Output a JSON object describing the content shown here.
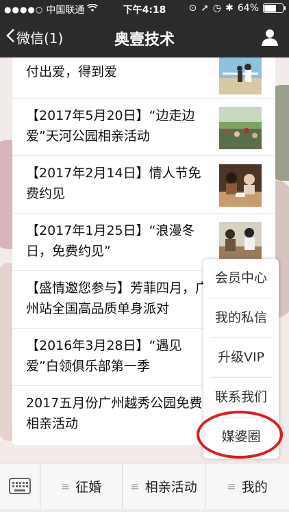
{
  "status_bar": {
    "carrier": "中国联通",
    "time": "下午4:18",
    "battery": "64%",
    "battery_level": 0.64
  },
  "nav": {
    "back_label": "微信(1)",
    "title": "奥壹技术"
  },
  "articles": [
    {
      "title": "付出爱，得到爱",
      "thumb": "couple-beach"
    },
    {
      "title": "【2017年5月20日】“边走边爱”天河公园相亲活动",
      "thumb": "park-crowd"
    },
    {
      "title": "【2017年2月14日】情人节免费约见",
      "thumb": "valentine-dinner"
    },
    {
      "title": "【2017年1月25日】“浪漫冬日，免费约见”",
      "thumb": "winter-date"
    },
    {
      "title": "【盛情邀您参与】芳菲四月，广州站全国高品质单身派对",
      "thumb": ""
    },
    {
      "title": "【2016年3月28日】“遇见爱”白领俱乐部第一季",
      "thumb": ""
    },
    {
      "title": "2017五月份广州越秀公园免费相亲活动",
      "thumb": ""
    }
  ],
  "menu": {
    "items": [
      "会员中心",
      "我的私信",
      "升级VIP",
      "联系我们",
      "媒婆圈"
    ],
    "highlight_color": "#e01b1b"
  },
  "tabbar": {
    "tabs": [
      "征婚",
      "相亲活动",
      "我的"
    ]
  },
  "colors": {
    "nav_bg": "#2c2c2c",
    "status_bg": "#2b2b2b"
  }
}
